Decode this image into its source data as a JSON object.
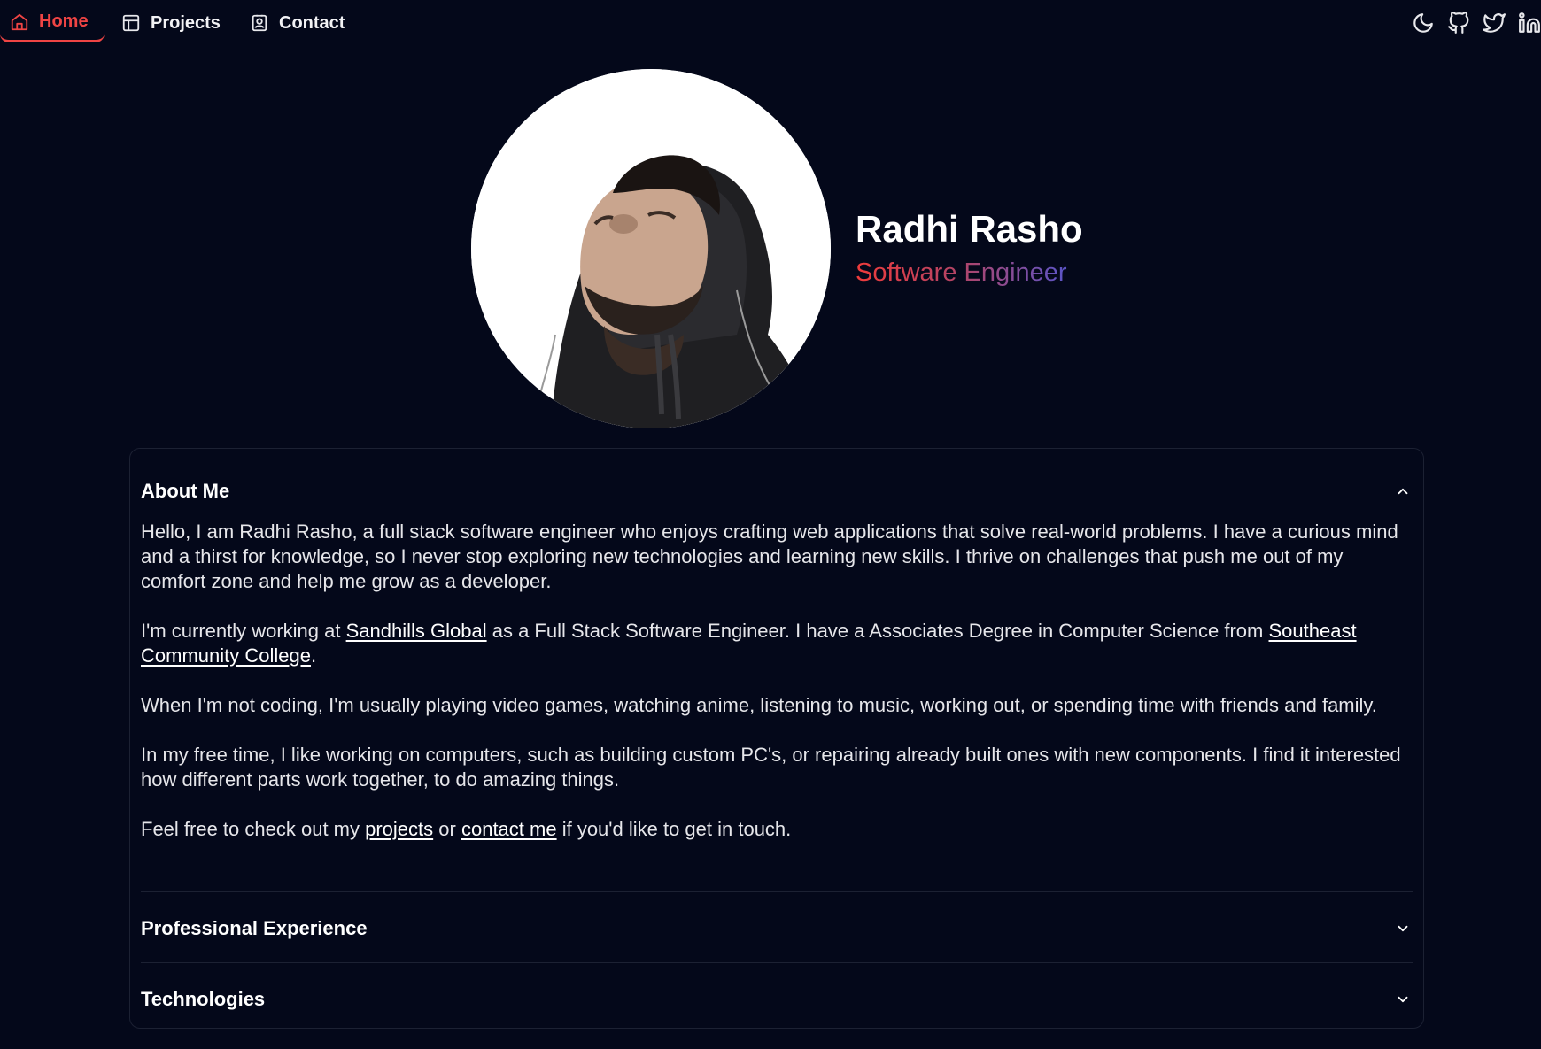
{
  "nav": {
    "items": [
      {
        "label": "Home",
        "icon": "home-icon",
        "active": true
      },
      {
        "label": "Projects",
        "icon": "layout-icon",
        "active": false
      },
      {
        "label": "Contact",
        "icon": "contact-card-icon",
        "active": false
      }
    ],
    "right_icons": [
      "moon-icon",
      "github-icon",
      "twitter-icon",
      "linkedin-icon"
    ]
  },
  "hero": {
    "name": "Radhi Rasho",
    "role": "Software Engineer"
  },
  "accordion": {
    "about": {
      "title": "About Me",
      "p1": "Hello, I am Radhi Rasho, a full stack software engineer who enjoys crafting web applications that solve real-world problems. I have a curious mind and a thirst for knowledge, so I never stop exploring new technologies and learning new skills. I thrive on challenges that push me out of my comfort zone and help me grow as a developer.",
      "p2_before": "I'm currently working at ",
      "p2_link1": "Sandhills Global",
      "p2_middle": " as a Full Stack Software Engineer. I have a Associates Degree in Computer Science from ",
      "p2_link2": "Southeast Community College",
      "p2_after": ".",
      "p3": "When I'm not coding, I'm usually playing video games, watching anime, listening to music, working out, or spending time with friends and family.",
      "p4": "In my free time, I like working on computers, such as building custom PC's, or repairing already built ones with new components. I find it interested how different parts work together, to do amazing things.",
      "p5_before": "Feel free to check out my ",
      "p5_link1": "projects",
      "p5_middle": " or ",
      "p5_link2": "contact me",
      "p5_after": " if you'd like to get in touch."
    },
    "experience": {
      "title": "Professional Experience"
    },
    "technologies": {
      "title": "Technologies"
    }
  },
  "colors": {
    "background": "#04081a",
    "accent": "#ef4444",
    "gradient_start": "#ef3b3b",
    "gradient_end": "#4e57d6"
  }
}
